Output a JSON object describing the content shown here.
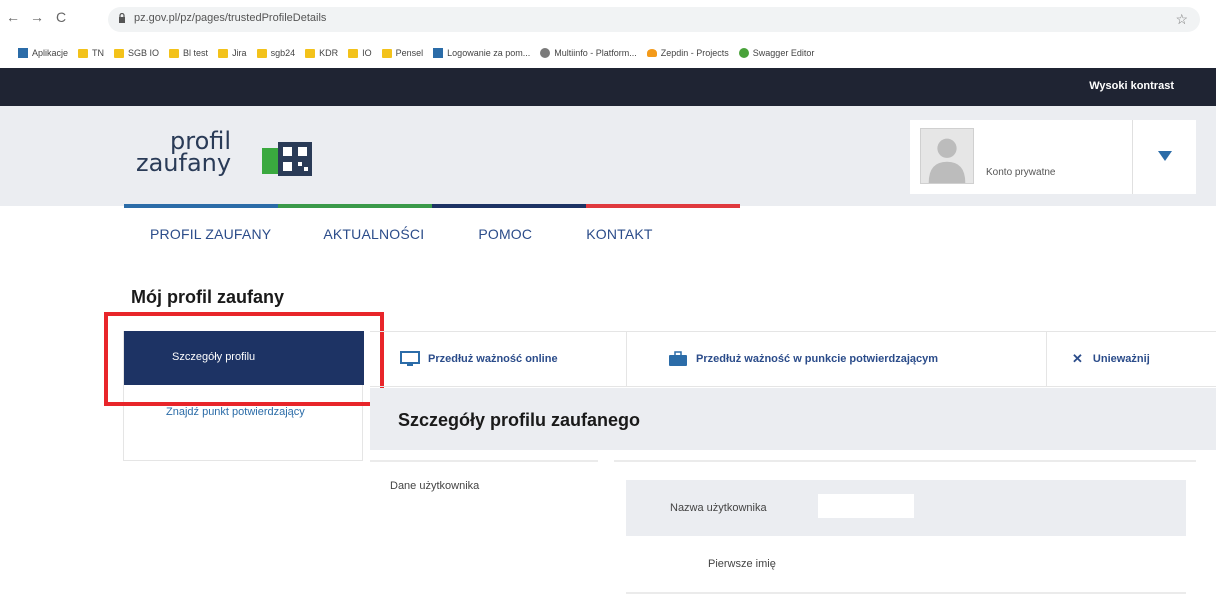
{
  "browser": {
    "url": "pz.gov.pl/pz/pages/trustedProfileDetails",
    "bookmarks": [
      "Aplikacje",
      "TN",
      "SGB IO",
      "Bl test",
      "Jira",
      "sgb24",
      "KDR",
      "IO",
      "Pensel",
      "Logowanie za pom...",
      "Multiinfo - Platform...",
      "Zepdin - Projects",
      "Swagger Editor"
    ]
  },
  "topbar": {
    "contrast_label": "Wysoki kontrast"
  },
  "logo": {
    "line1": "profil",
    "line2": "zaufany"
  },
  "account": {
    "label": "Konto prywatne"
  },
  "nav": [
    "PROFIL ZAUFANY",
    "AKTUALNOŚCI",
    "POMOC",
    "KONTAKT"
  ],
  "page_title": "Mój profil zaufany",
  "side_menu": {
    "active": "Szczegóły profilu",
    "items": [
      "Znajdź punkt potwierdzający"
    ]
  },
  "actions": {
    "extend_online": "Przedłuż ważność online",
    "extend_point": "Przedłuż ważność w punkcie potwierdzającym",
    "invalidate": "Unieważnij"
  },
  "section": {
    "title": "Szczegóły profilu zaufanego",
    "user_data": "Dane użytkownika",
    "fields": {
      "username": "Nazwa użytkownika",
      "first_name": "Pierwsze imię"
    }
  },
  "colors": {
    "topbar": "#1f2433",
    "side_active": "#1d3364",
    "highlight": "#e8252a",
    "strip": [
      "#2b6ca8",
      "#3a9a4a",
      "#1d3364",
      "#e0393e"
    ]
  }
}
